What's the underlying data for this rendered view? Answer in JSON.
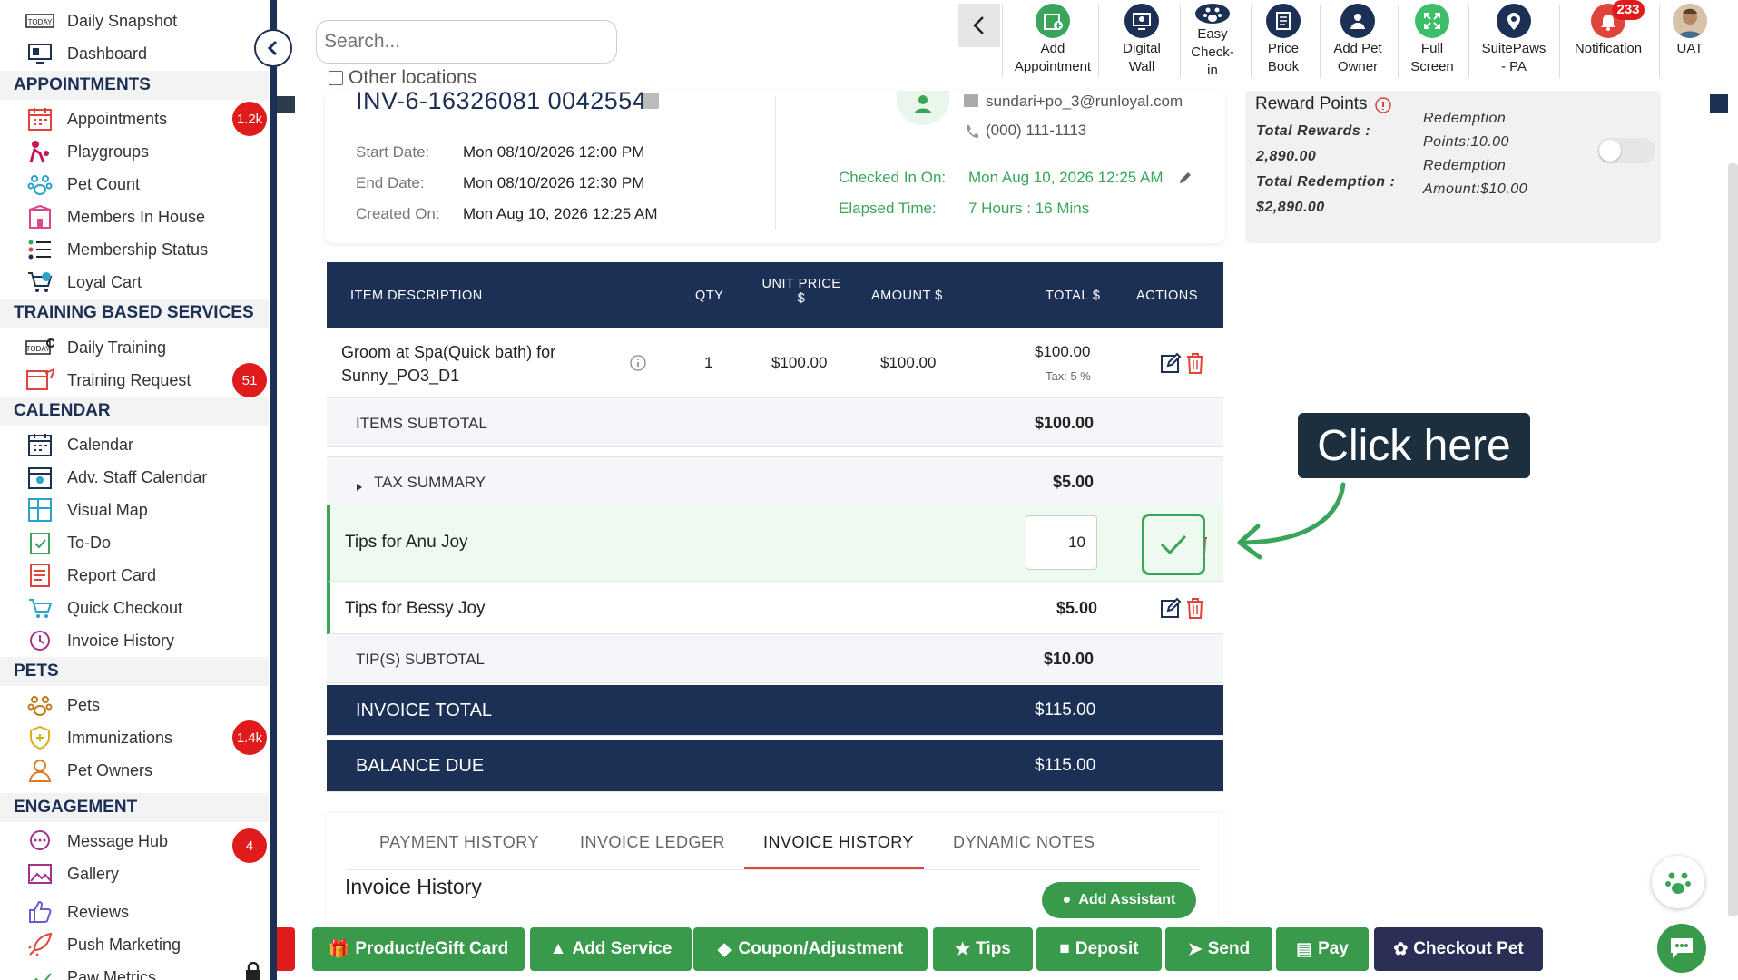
{
  "sidebar": {
    "items": [
      {
        "label": "Daily Snapshot"
      },
      {
        "label": "Dashboard"
      },
      {
        "label": "APPOINTMENTS"
      },
      {
        "label": "Appointments",
        "badge": "1.2k"
      },
      {
        "label": "Playgroups"
      },
      {
        "label": "Pet Count"
      },
      {
        "label": "Members In House"
      },
      {
        "label": "Membership Status"
      },
      {
        "label": "Loyal Cart"
      },
      {
        "label": "TRAINING BASED SERVICES"
      },
      {
        "label": "Daily Training"
      },
      {
        "label": "Training Request",
        "badge": "51"
      },
      {
        "label": "CALENDAR"
      },
      {
        "label": "Calendar"
      },
      {
        "label": "Adv. Staff Calendar"
      },
      {
        "label": "Visual Map"
      },
      {
        "label": "To-Do"
      },
      {
        "label": "Report Card"
      },
      {
        "label": "Quick Checkout"
      },
      {
        "label": "Invoice History"
      },
      {
        "label": "PETS"
      },
      {
        "label": "Pets"
      },
      {
        "label": "Immunizations",
        "badge": "1.4k"
      },
      {
        "label": "Pet Owners"
      },
      {
        "label": "ENGAGEMENT"
      },
      {
        "label": "Message Hub",
        "badge": "4"
      },
      {
        "label": "Gallery"
      },
      {
        "label": "Reviews"
      },
      {
        "label": "Push Marketing"
      },
      {
        "label": "Paw Metrics"
      }
    ]
  },
  "search": {
    "placeholder": "Search..."
  },
  "other_locations": "Other locations",
  "toolbar": {
    "add_appointment": "Add Appointment",
    "digital_wall": "Digital Wall",
    "easy_checkin": "Easy Check-in",
    "price_book": "Price Book",
    "add_pet_owner": "Add Pet Owner",
    "full_screen": "Full Screen",
    "suitepaws": "SuitePaws - PA",
    "notification": "Notification",
    "notification_count": "233",
    "user": "UAT"
  },
  "invoice": {
    "number": "INV-6-16326081 0042554",
    "start_label": "Start Date:",
    "start": "Mon 08/10/2026 12:00 PM",
    "end_label": "End Date:",
    "end": "Mon 08/10/2026 12:30 PM",
    "created_label": "Created On:",
    "created": "Mon Aug 10, 2026 12:25 AM",
    "email": "sundari+po_3@runloyal.com",
    "phone": "(000) 111-1113",
    "checked_in_label": "Checked In On:",
    "checked_in": "Mon Aug 10, 2026 12:25 AM",
    "elapsed_label": "Elapsed Time:",
    "elapsed": "7 Hours : 16 Mins"
  },
  "reward": {
    "title": "Reward Points",
    "total_rewards_label": "Total Rewards :",
    "total_rewards": "2,890.00",
    "total_redemption_label": "Total Redemption :",
    "total_redemption": "$2,890.00",
    "redemption_points_1": "Redemption",
    "redemption_points_2": "Points:10.00",
    "redemption_amount_1": "Redemption",
    "redemption_amount_2": "Amount:$10.00"
  },
  "table": {
    "headers": {
      "item": "ITEM DESCRIPTION",
      "qty": "QTY",
      "unit_price_1": "UNIT PRICE",
      "unit_price_2": "$",
      "amount": "AMOUNT $",
      "total": "TOTAL $",
      "actions": "ACTIONS"
    },
    "item": {
      "desc_1": "Groom at Spa(Quick bath) for",
      "desc_2": "Sunny_PO3_D1",
      "qty": "1",
      "unit_price": "$100.00",
      "amount": "$100.00",
      "total": "$100.00",
      "tax": "Tax: 5 %"
    },
    "items_subtotal_label": "ITEMS SUBTOTAL",
    "items_subtotal": "$100.00",
    "tax_summary_label": "TAX SUMMARY",
    "tax_summary": "$5.00",
    "tip1_label": "Tips for Anu Joy",
    "tip1_value": "10",
    "tip2_label": "Tips for Bessy Joy",
    "tip2_value": "$5.00",
    "tips_subtotal_label": "TIP(S) SUBTOTAL",
    "tips_subtotal": "$10.00",
    "invoice_total_label": "INVOICE TOTAL",
    "invoice_total": "$115.00",
    "balance_due_label": "BALANCE DUE",
    "balance_due": "$115.00"
  },
  "callout": "Click here",
  "tabs": {
    "payment_history": "PAYMENT HISTORY",
    "invoice_ledger": "INVOICE LEDGER",
    "invoice_history": "INVOICE HISTORY",
    "dynamic_notes": "DYNAMIC NOTES",
    "section_title": "Invoice History",
    "add_assistant": "Add Assistant"
  },
  "actions": {
    "product": "Product/eGift Card",
    "add_service": "Add Service",
    "coupon": "Coupon/Adjustment",
    "tips": "Tips",
    "deposit": "Deposit",
    "send": "Send",
    "pay": "Pay",
    "checkout": "Checkout Pet"
  },
  "colors": {
    "navy": "#1c2f55",
    "green": "#3aa55a",
    "red": "#e01b1b"
  }
}
